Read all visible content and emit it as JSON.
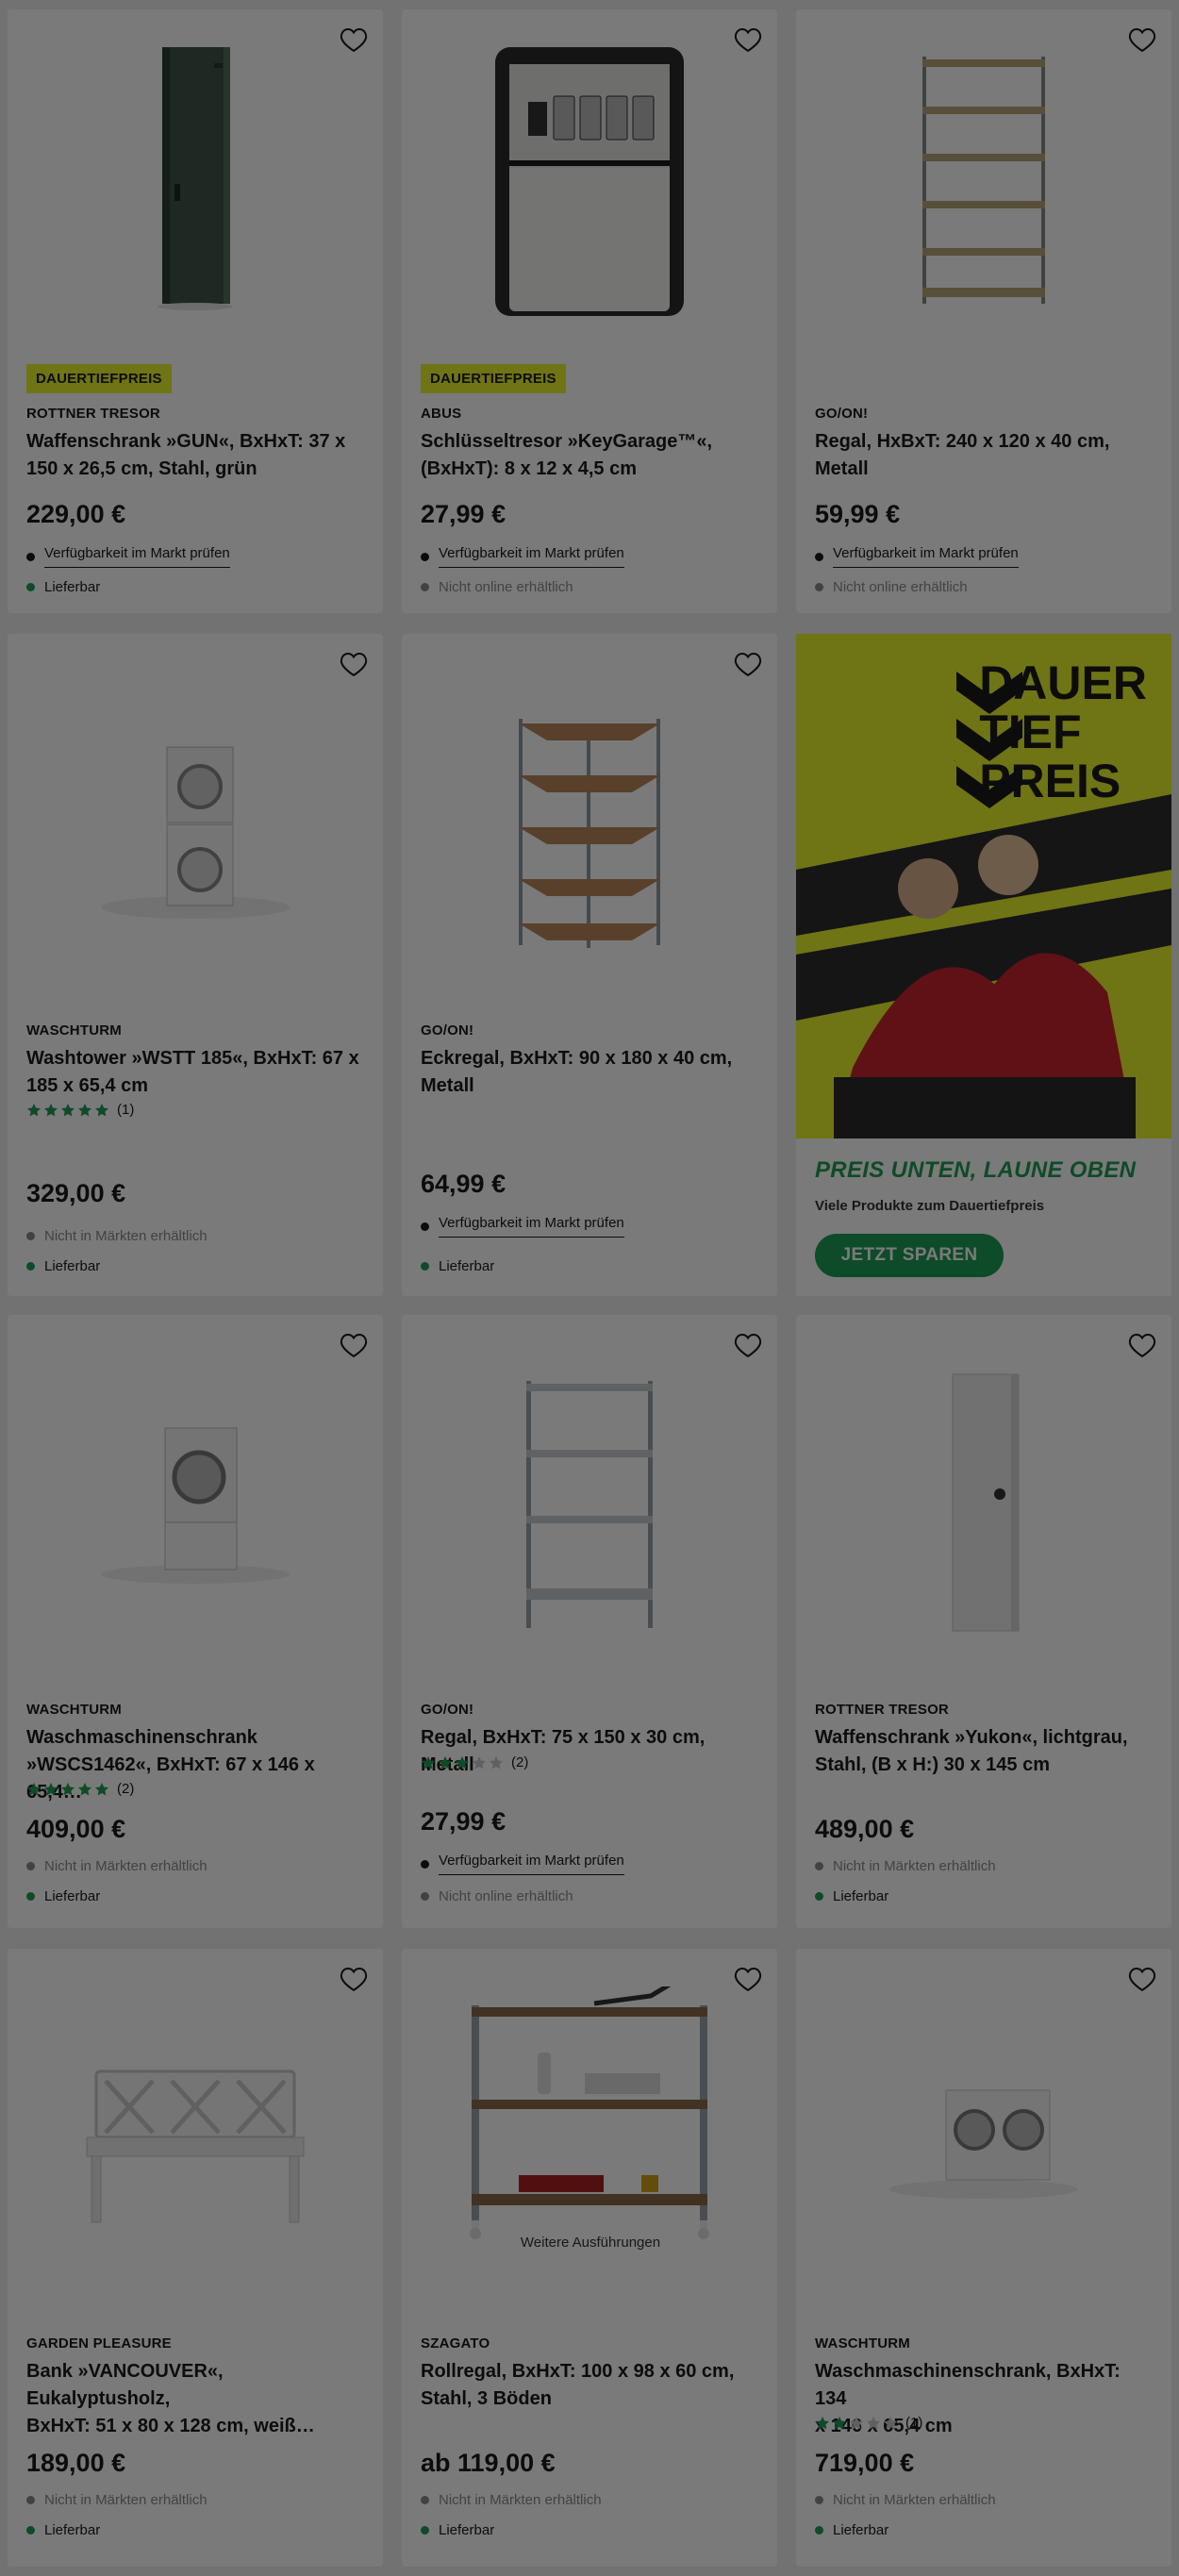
{
  "colors": {
    "badge_yellow": "#e8f32c",
    "green_dot": "#1f9d55",
    "grey_dot": "#8a8a8a",
    "black_dot": "#1a1a1a",
    "star_green": "#1f9d55"
  },
  "cards": [
    {
      "id": "c1",
      "favorite_icon": "heart-outline-icon",
      "badge": "DAUERTIEFPREIS",
      "brand": "ROTTNER TRESOR",
      "title_line1": "Waffenschrank »GUN«, BxHxT: 37 x",
      "title_line2": "150 x 26,5 cm, Stahl, grün",
      "price": "229,00 €",
      "avail1": "Verfügbarkeit im Markt prüfen",
      "avail2": "Lieferbar"
    },
    {
      "id": "c2",
      "favorite_icon": "heart-outline-icon",
      "badge": "DAUERTIEFPREIS",
      "brand": "ABUS",
      "title_line1": "Schlüsseltresor »KeyGarage™«,",
      "title_line2": "(BxHxT): 8 x 12 x 4,5 cm",
      "price": "27,99 €",
      "avail1": "Verfügbarkeit im Markt prüfen",
      "avail2": "Nicht online erhältlich"
    },
    {
      "id": "c3",
      "favorite_icon": "heart-outline-icon",
      "brand": "GO/ON!",
      "title_line1": "Regal, HxBxT: 240 x 120 x 40 cm, Metall",
      "title_line2": "",
      "price": "59,99 €",
      "avail1": "Verfügbarkeit im Markt prüfen",
      "avail2": "Nicht online erhältlich"
    },
    {
      "id": "c4",
      "favorite_icon": "heart-outline-icon",
      "brand": "WASCHTURM",
      "title_line1": "Washtower »WSTT 185«, BxHxT: 67 x",
      "title_line2": "185 x 65,4 cm",
      "rating": 5,
      "rating_count": "(1)",
      "price": "329,00 €",
      "avail1": "Nicht in Märkten erhältlich",
      "avail2": "Lieferbar"
    },
    {
      "id": "c5",
      "favorite_icon": "heart-outline-icon",
      "brand": "GO/ON!",
      "title_line1": "Eckregal, BxHxT: 90 x 180 x 40 cm,",
      "title_line2": "Metall",
      "price": "64,99 €",
      "avail1": "Verfügbarkeit im Markt prüfen",
      "avail2": "Lieferbar"
    },
    {
      "id": "c6",
      "favorite_icon": "heart-outline-icon",
      "brand": "WASCHTURM",
      "title_line1": "Waschmaschinenschrank",
      "title_line2": "»WSCS1462«, BxHxT: 67 x 146 x 65,4…",
      "rating": 5,
      "rating_count": "(2)",
      "price": "409,00 €",
      "avail1": "Nicht in Märkten erhältlich",
      "avail2": "Lieferbar"
    },
    {
      "id": "c7",
      "favorite_icon": "heart-outline-icon",
      "brand": "GO/ON!",
      "title_line1": "Regal, BxHxT: 75 x 150 x 30 cm, Metall",
      "title_line2": "",
      "rating": 3,
      "rating_count": "(2)",
      "price": "27,99 €",
      "avail1": "Verfügbarkeit im Markt prüfen",
      "avail2": "Nicht online erhältlich"
    },
    {
      "id": "c8",
      "favorite_icon": "heart-outline-icon",
      "brand": "ROTTNER TRESOR",
      "title_line1": "Waffenschrank »Yukon«, lichtgrau,",
      "title_line2": "Stahl, (B x H:) 30 x 145 cm",
      "price": "489,00 €",
      "avail1": "Nicht in Märkten erhältlich",
      "avail2": "Lieferbar"
    },
    {
      "id": "c9",
      "favorite_icon": "heart-outline-icon",
      "brand": "GARDEN PLEASURE",
      "title_line1": "Bank »VANCOUVER«, Eukalyptusholz,",
      "title_line2": "BxHxT: 51 x 80 x 128 cm, weiß…",
      "price": "189,00 €",
      "avail1": "Nicht in Märkten erhältlich",
      "avail2": "Lieferbar"
    },
    {
      "id": "c10",
      "favorite_icon": "heart-outline-icon",
      "brand": "SZAGATO",
      "title_line1": "Rollregal, BxHxT: 100 x 98 x 60 cm,",
      "title_line2": "Stahl, 3 Böden",
      "further": "Weitere Ausführungen",
      "price": "ab 119,00 €",
      "avail1": "Nicht in Märkten erhältlich",
      "avail2": "Lieferbar"
    },
    {
      "id": "c11",
      "favorite_icon": "heart-outline-icon",
      "brand": "WASCHTURM",
      "title_line1": "Waschmaschinenschrank, BxHxT: 134",
      "title_line2": "x 146 x 65,4 cm",
      "rating": 2,
      "rating_count": "(1)",
      "price": "719,00 €",
      "avail1": "Nicht in Märkten erhältlich",
      "avail2": "Lieferbar"
    }
  ],
  "promo": {
    "logo_line1": "DAUER",
    "logo_line2": "TIEF",
    "logo_line3": "PREIS",
    "headline": "PREIS UNTEN, LAUNE OBEN",
    "subline": "Viele Produkte zum Dauertiefpreis",
    "cta": "JETZT SPAREN"
  }
}
